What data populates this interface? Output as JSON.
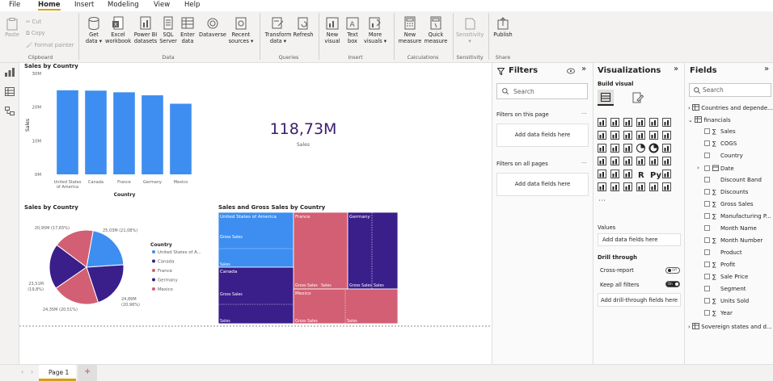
{
  "menu": {
    "file": "File",
    "home": "Home",
    "insert": "Insert",
    "modeling": "Modeling",
    "view": "View",
    "help": "Help"
  },
  "ribbon": {
    "paste": "Paste",
    "cut": "Cut",
    "copy": "Copy",
    "format_painter": "Format painter",
    "clipboard": "Clipboard",
    "get_data": [
      "Get",
      "data ▾"
    ],
    "excel": [
      "Excel",
      "workbook"
    ],
    "powerbi": [
      "Power BI",
      "datasets"
    ],
    "sql": [
      "SQL",
      "Server"
    ],
    "enter": [
      "Enter",
      "data"
    ],
    "dataverse": [
      "Dataverse",
      ""
    ],
    "recent": [
      "Recent",
      "sources ▾"
    ],
    "data_group": "Data",
    "transform": [
      "Transform",
      "data ▾"
    ],
    "refresh": [
      "Refresh",
      ""
    ],
    "queries": "Queries",
    "new_visual": [
      "New",
      "visual"
    ],
    "text_box": [
      "Text",
      "box"
    ],
    "more_visuals": [
      "More",
      "visuals ▾"
    ],
    "insert_group": "Insert",
    "new_measure": [
      "New",
      "measure"
    ],
    "quick_measure": [
      "Quick",
      "measure"
    ],
    "calculations": "Calculations",
    "sensitivity": [
      "Sensitivity",
      "▾"
    ],
    "sensitivity_group": "Sensitivity",
    "publish": [
      "Publish",
      ""
    ],
    "share": "Share"
  },
  "bar_chart": {
    "title": "Sales by Country",
    "ylabel": "Sales",
    "xlabel": "Country"
  },
  "card": {
    "value": "118,73M",
    "label": "Sales"
  },
  "pie_chart": {
    "title": "Sales by Country",
    "legend_title": "Country"
  },
  "treemap": {
    "title": "Sales and Gross Sales by Country"
  },
  "filters": {
    "title": "Filters",
    "search_placeholder": "Search",
    "on_page": "Filters on this page",
    "all_pages": "Filters on all pages",
    "add": "Add data fields here",
    "ellipsis": "..."
  },
  "viz": {
    "title": "Visualizations",
    "build": "Build visual",
    "values": "Values",
    "values_add": "Add data fields here",
    "drill": "Drill through",
    "cross": "Cross-report",
    "cross_state": "Off",
    "keep": "Keep all filters",
    "keep_state": "On",
    "drill_add": "Add drill-through fields here"
  },
  "fields": {
    "title": "Fields",
    "search_placeholder": "Search",
    "tables": [
      "Countries and depende...",
      "financials",
      "Sovereign states and d..."
    ],
    "items": [
      {
        "name": "Sales",
        "sigma": true
      },
      {
        "name": "COGS",
        "sigma": true
      },
      {
        "name": "Country",
        "sigma": false
      },
      {
        "name": "Date",
        "sigma": false
      },
      {
        "name": "Discount Band",
        "sigma": false
      },
      {
        "name": "Discounts",
        "sigma": true
      },
      {
        "name": "Gross Sales",
        "sigma": true
      },
      {
        "name": "Manufacturing P...",
        "sigma": true
      },
      {
        "name": "Month Name",
        "sigma": false
      },
      {
        "name": "Month Number",
        "sigma": true
      },
      {
        "name": "Product",
        "sigma": false
      },
      {
        "name": "Profit",
        "sigma": true
      },
      {
        "name": "Sale Price",
        "sigma": true
      },
      {
        "name": "Segment",
        "sigma": false
      },
      {
        "name": "Units Sold",
        "sigma": true
      },
      {
        "name": "Year",
        "sigma": true
      }
    ]
  },
  "pages": {
    "page1": "Page 1"
  },
  "colors": {
    "blue": "#3d8ef0",
    "navy": "#3a1e8a",
    "pink": "#d25f73",
    "accent": "#d4a017"
  },
  "chart_data": [
    {
      "type": "bar",
      "title": "Sales by Country",
      "xlabel": "Country",
      "ylabel": "Sales",
      "categories": [
        "United States of America",
        "Canada",
        "France",
        "Germany",
        "Mexico"
      ],
      "values": [
        25.0,
        24.9,
        24.4,
        23.5,
        21.0
      ],
      "yticks": [
        "0M",
        "10M",
        "20M",
        "30M"
      ],
      "ylim": [
        0,
        30
      ],
      "grid": false
    },
    {
      "type": "pie",
      "title": "Sales by Country",
      "legend_title": "Country",
      "legend_position": "right",
      "slices": [
        {
          "name": "United States of A...",
          "value": 25.03,
          "label": "25,03M (21,08%)",
          "color": "#3d8ef0"
        },
        {
          "name": "Canada",
          "value": 24.89,
          "label": "24,89M (20,96%)",
          "color": "#3a1e8a"
        },
        {
          "name": "France",
          "value": 24.35,
          "label": "24,35M (20,51%)",
          "color": "#d25f73"
        },
        {
          "name": "Germany",
          "value": 23.51,
          "label": "23,51M (19,8%)",
          "color": "#3a1e8a"
        },
        {
          "name": "Mexico",
          "value": 20.95,
          "label": "20,95M (17,65%)",
          "color": "#d25f73"
        }
      ]
    },
    {
      "type": "treemap",
      "title": "Sales and Gross Sales by Country",
      "groups": [
        {
          "name": "United States of America",
          "color": "#3d8ef0",
          "children": [
            "Gross Sales",
            "Sales"
          ]
        },
        {
          "name": "France",
          "color": "#d25f73",
          "children": [
            "Gross Sales",
            "Sales"
          ]
        },
        {
          "name": "Germany",
          "color": "#3a1e8a",
          "children": [
            "Gross Sales",
            "Sales"
          ]
        },
        {
          "name": "Canada",
          "color": "#3a1e8a",
          "children": [
            "Gross Sales",
            "Sales"
          ]
        },
        {
          "name": "Mexico",
          "color": "#d25f73",
          "children": [
            "Gross Sales",
            "Sales"
          ]
        }
      ]
    }
  ]
}
